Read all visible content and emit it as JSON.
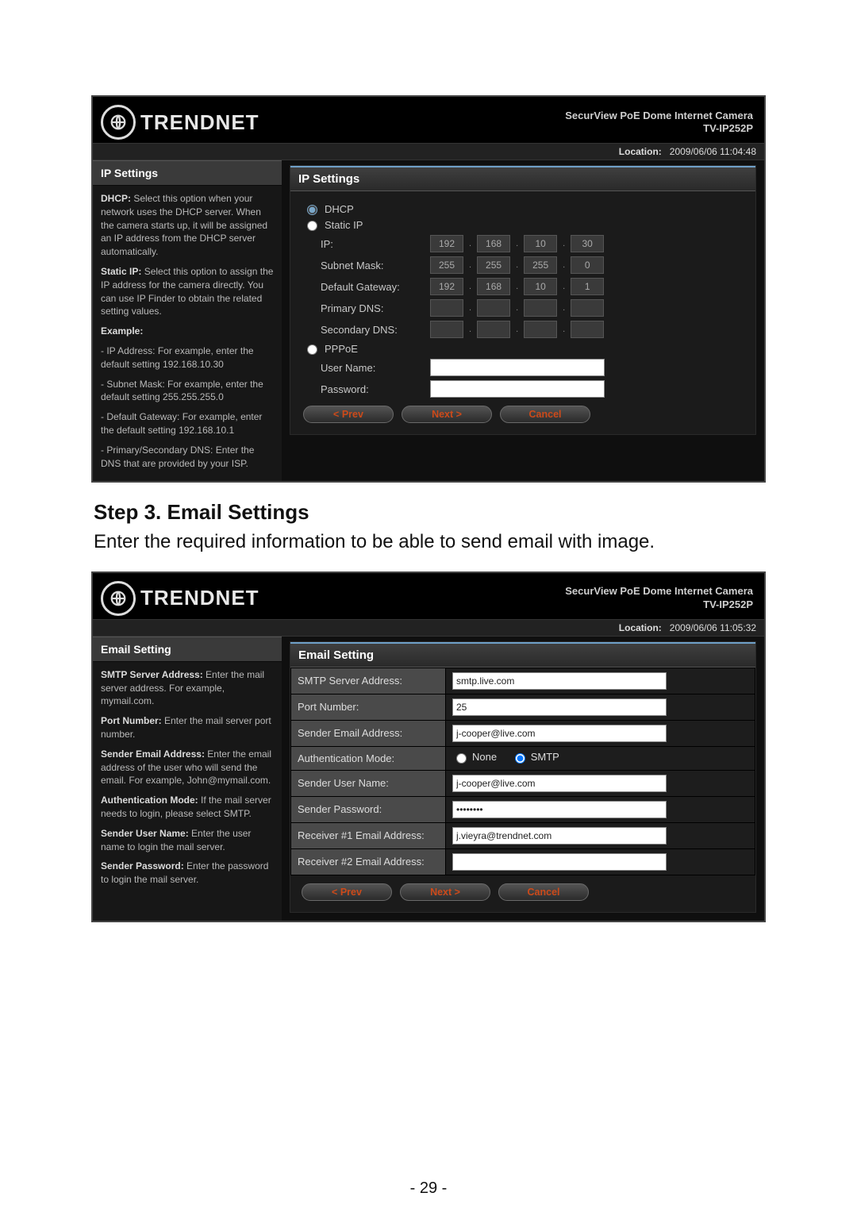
{
  "brand": "TRENDNET",
  "product_line": "SecurView PoE Dome Internet Camera",
  "model": "TV-IP252P",
  "loc_label": "Location:",
  "panel1": {
    "timestamp": "2009/06/06 11:04:48",
    "side_title": "IP Settings",
    "side_html": [
      {
        "b": "DHCP:",
        "t": " Select this option when your network uses the DHCP server. When the camera starts up, it will be assigned an IP address from the DHCP server automatically."
      },
      {
        "b": "Static IP:",
        "t": " Select this option to assign the IP address for the camera directly. You can use IP Finder to obtain the related setting values."
      },
      {
        "b": "Example:",
        "t": ""
      },
      {
        "b": "",
        "t": "- IP Address: For example, enter the default setting 192.168.10.30"
      },
      {
        "b": "",
        "t": "- Subnet Mask: For example, enter the default setting 255.255.255.0"
      },
      {
        "b": "",
        "t": "- Default Gateway: For example, enter the default setting 192.168.10.1"
      },
      {
        "b": "",
        "t": "- Primary/Secondary DNS: Enter the DNS that are provided by your ISP."
      }
    ],
    "main_title": "IP Settings",
    "dhcp_label": "DHCP",
    "static_label": "Static IP",
    "pppoe_label": "PPPoE",
    "rows": {
      "ip": "IP:",
      "subnet": "Subnet Mask:",
      "gw": "Default Gateway:",
      "pdns": "Primary DNS:",
      "sdns": "Secondary DNS:",
      "user": "User Name:",
      "pass": "Password:"
    },
    "ip": [
      "192",
      "168",
      "10",
      "30"
    ],
    "mask": [
      "255",
      "255",
      "255",
      "0"
    ],
    "gw": [
      "192",
      "168",
      "10",
      "1"
    ]
  },
  "panel2": {
    "timestamp": "2009/06/06 11:05:32",
    "side_title": "Email Setting",
    "side_html": [
      {
        "b": "SMTP Server Address:",
        "t": " Enter the mail server address. For example, mymail.com."
      },
      {
        "b": "Port Number:",
        "t": " Enter the mail server port number."
      },
      {
        "b": "Sender Email Address:",
        "t": " Enter the email address of the user who will send the email. For example, John@mymail.com."
      },
      {
        "b": "Authentication Mode:",
        "t": " If the mail server needs to login, please select SMTP."
      },
      {
        "b": "Sender User Name:",
        "t": " Enter the user name to login the mail server."
      },
      {
        "b": "Sender Password:",
        "t": " Enter the password to login the mail server."
      }
    ],
    "main_title": "Email Setting",
    "labels": {
      "smtp": "SMTP Server Address:",
      "port": "Port Number:",
      "sender": "Sender Email Address:",
      "auth": "Authentication Mode:",
      "suser": "Sender User Name:",
      "spass": "Sender Password:",
      "r1": "Receiver #1 Email Address:",
      "r2": "Receiver #2 Email Address:",
      "none": "None",
      "smtpr": "SMTP"
    },
    "values": {
      "smtp": "smtp.live.com",
      "port": "25",
      "sender": "j-cooper@live.com",
      "suser": "j-cooper@live.com",
      "spass": "••••••••",
      "r1": "j.vieyra@trendnet.com",
      "r2": ""
    }
  },
  "buttons": {
    "prev": "< Prev",
    "next": "Next >",
    "cancel": "Cancel"
  },
  "doc": {
    "heading": "Step 3. Email Settings",
    "para": "Enter the required information to be able to send email with image.",
    "page": "- 29 -"
  }
}
